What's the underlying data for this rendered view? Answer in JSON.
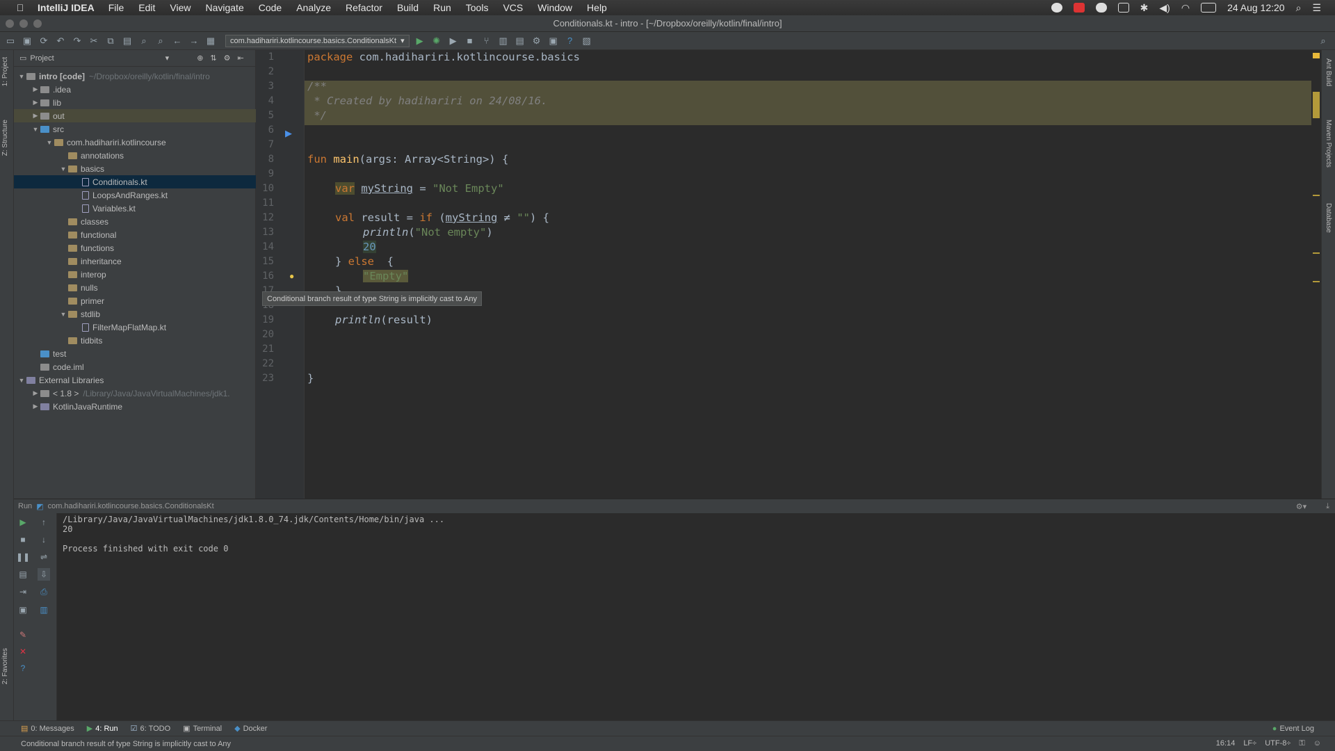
{
  "menubar": {
    "app": "IntelliJ IDEA",
    "items": [
      "File",
      "Edit",
      "View",
      "Navigate",
      "Code",
      "Analyze",
      "Refactor",
      "Build",
      "Run",
      "Tools",
      "VCS",
      "Window",
      "Help"
    ],
    "clock": "24 Aug 12:20"
  },
  "window": {
    "title": "Conditionals.kt - intro - [~/Dropbox/oreilly/kotlin/final/intro]"
  },
  "toolbar": {
    "run_config": "com.hadihariri.kotlincourse.basics.ConditionalsKt"
  },
  "left_strip": {
    "project": "1: Project",
    "structure": "Z: Structure",
    "favorites": "2: Favorites"
  },
  "right_strip": {
    "ant": "Ant Build",
    "maven": "Maven Projects",
    "database": "Database"
  },
  "project": {
    "header": "Project",
    "tree": [
      {
        "label": "intro [code]",
        "hint": "~/Dropbox/oreilly/kotlin/final/intro",
        "arrow": "▼",
        "icon": "folder"
      },
      {
        "label": ".idea",
        "hint": "",
        "arrow": "▶",
        "icon": "folder"
      },
      {
        "label": "lib",
        "hint": "",
        "arrow": "▶",
        "icon": "folder"
      },
      {
        "label": "out",
        "hint": "",
        "arrow": "▶",
        "icon": "folder"
      },
      {
        "label": "src",
        "hint": "",
        "arrow": "▼",
        "icon": "src"
      },
      {
        "label": "com.hadihariri.kotlincourse",
        "hint": "",
        "arrow": "▼",
        "icon": "pkg"
      },
      {
        "label": "annotations",
        "hint": "",
        "arrow": "",
        "icon": "pkg"
      },
      {
        "label": "basics",
        "hint": "",
        "arrow": "▼",
        "icon": "pkg"
      },
      {
        "label": "Conditionals.kt",
        "hint": "",
        "arrow": "",
        "icon": "kt"
      },
      {
        "label": "LoopsAndRanges.kt",
        "hint": "",
        "arrow": "",
        "icon": "kt"
      },
      {
        "label": "Variables.kt",
        "hint": "",
        "arrow": "",
        "icon": "kt"
      },
      {
        "label": "classes",
        "hint": "",
        "arrow": "",
        "icon": "pkg"
      },
      {
        "label": "functional",
        "hint": "",
        "arrow": "",
        "icon": "pkg"
      },
      {
        "label": "functions",
        "hint": "",
        "arrow": "",
        "icon": "pkg"
      },
      {
        "label": "inheritance",
        "hint": "",
        "arrow": "",
        "icon": "pkg"
      },
      {
        "label": "interop",
        "hint": "",
        "arrow": "",
        "icon": "pkg"
      },
      {
        "label": "nulls",
        "hint": "",
        "arrow": "",
        "icon": "pkg"
      },
      {
        "label": "primer",
        "hint": "",
        "arrow": "",
        "icon": "pkg"
      },
      {
        "label": "stdlib",
        "hint": "",
        "arrow": "▼",
        "icon": "pkg"
      },
      {
        "label": "FilterMapFlatMap.kt",
        "hint": "",
        "arrow": "",
        "icon": "kt"
      },
      {
        "label": "tidbits",
        "hint": "",
        "arrow": "",
        "icon": "pkg"
      },
      {
        "label": "test",
        "hint": "",
        "arrow": "",
        "icon": "src"
      },
      {
        "label": "code.iml",
        "hint": "",
        "arrow": "",
        "icon": "file"
      },
      {
        "label": "External Libraries",
        "hint": "",
        "arrow": "▼",
        "icon": "lib"
      },
      {
        "label": "< 1.8 >",
        "hint": "/Library/Java/JavaVirtualMachines/jdk1.",
        "arrow": "▶",
        "icon": "folder"
      },
      {
        "label": "KotlinJavaRuntime",
        "hint": "",
        "arrow": "▶",
        "icon": "lib"
      }
    ]
  },
  "editor": {
    "line_numbers": [
      "1",
      "2",
      "3",
      "4",
      "5",
      "6",
      "7",
      "8",
      "9",
      "10",
      "11",
      "12",
      "13",
      "14",
      "15",
      "16",
      "17",
      "18",
      "19",
      "20",
      "21",
      "22",
      "23"
    ],
    "code": {
      "l1_kw": "package",
      "l1_rest": " com.hadihariri.kotlincourse.basics",
      "l3": "/**",
      "l4": " * Created by hadihariri on 24/08/16.",
      "l5": " */",
      "l8_kw": "fun",
      "l8_fn": "main",
      "l8_rest": "(args: Array<String>) {",
      "l10_kw": "var",
      "l10_name": "myString",
      "l10_eq": " = ",
      "l10_str": "\"Not Empty\"",
      "l12_kw": "val",
      "l12_mid": " result = ",
      "l12_if": "if",
      "l12_open": " (",
      "l12_var": "myString",
      "l12_cmp": " ≠ ",
      "l12_str": "\"\"",
      "l12_end": ") {",
      "l13_fn": "println",
      "l13_open": "(",
      "l13_str": "\"Not empty\"",
      "l13_end": ")",
      "l14_num": "20",
      "l15_a": "} ",
      "l15_kw": "else",
      "l15_b": "  {",
      "l16_str": "\"Empty\"",
      "l17": "}",
      "l19_fn": "println",
      "l19_rest": "(result)",
      "l23": "}"
    }
  },
  "tooltip": "Conditional branch result of type String is implicitly cast to Any",
  "run": {
    "header_label": "Run",
    "config": "com.hadihariri.kotlincourse.basics.ConditionalsKt",
    "console": [
      "/Library/Java/JavaVirtualMachines/jdk1.8.0_74.jdk/Contents/Home/bin/java ...",
      "20",
      "",
      "Process finished with exit code 0"
    ]
  },
  "bottom_tabs": {
    "messages": "0: Messages",
    "run": "4: Run",
    "todo": "6: TODO",
    "terminal": "Terminal",
    "docker": "Docker",
    "event_log": "Event Log"
  },
  "statusbar": {
    "message": "Conditional branch result of type String is implicitly cast to Any",
    "position": "16:14",
    "line_sep": "LF÷",
    "encoding": "UTF-8÷"
  }
}
